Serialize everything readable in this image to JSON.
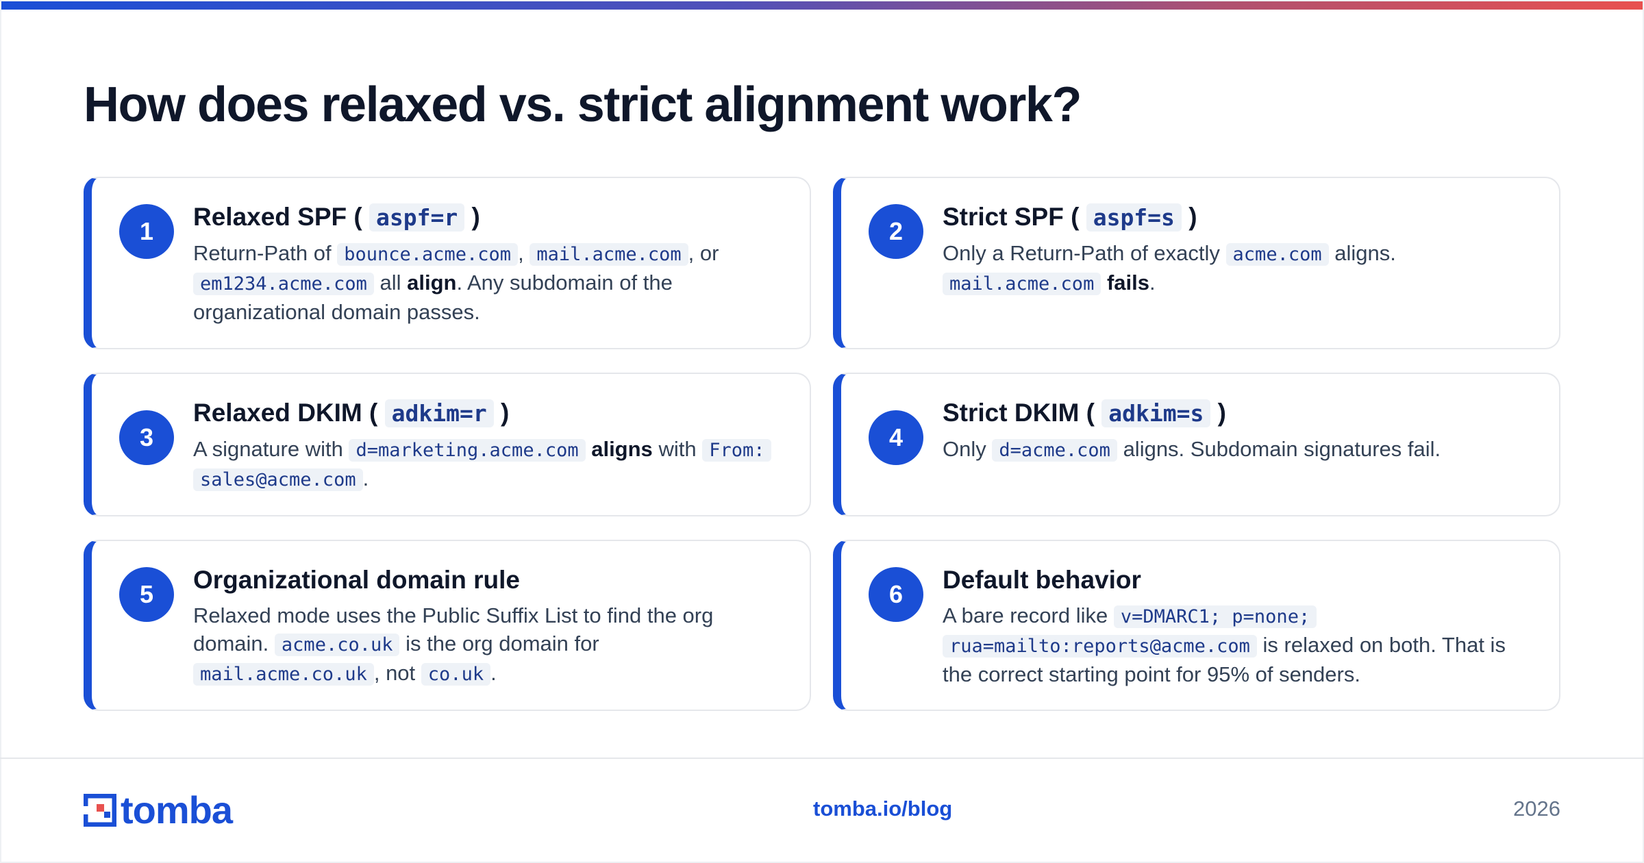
{
  "title": "How does relaxed vs. strict alignment work?",
  "cards": [
    {
      "number": "1",
      "title_text": "Relaxed SPF (",
      "title_code": "aspf=r",
      "title_end": ")",
      "parts": {
        "t1": "Return-Path of",
        "c1": "bounce.acme.com",
        "t2": ",",
        "c2": "mail.acme.com",
        "t3": ", or",
        "c3": "em1234.acme.com",
        "t4": "all",
        "b1": "align",
        "t5": ". Any subdomain of the organizational domain passes."
      }
    },
    {
      "number": "2",
      "title_text": "Strict SPF (",
      "title_code": "aspf=s",
      "title_end": ")",
      "parts": {
        "t1": "Only a Return-Path of exactly",
        "c1": "acme.com",
        "t2": "aligns.",
        "c2": "mail.acme.com",
        "b1": "fails",
        "t3": "."
      }
    },
    {
      "number": "3",
      "title_text": "Relaxed DKIM (",
      "title_code": "adkim=r",
      "title_end": ")",
      "parts": {
        "t1": "A signature with",
        "c1": "d=marketing.acme.com",
        "b1": "aligns",
        "t2": "with",
        "c2": "From:",
        "c3": "sales@acme.com",
        "t3": "."
      }
    },
    {
      "number": "4",
      "title_text": "Strict DKIM (",
      "title_code": "adkim=s",
      "title_end": ")",
      "parts": {
        "t1": "Only",
        "c1": "d=acme.com",
        "t2": "aligns. Subdomain signatures fail."
      }
    },
    {
      "number": "5",
      "title_text": "Organizational domain rule",
      "parts": {
        "t1": "Relaxed mode uses the Public Suffix List to find the org domain.",
        "c1": "acme.co.uk",
        "t2": "is the org domain for",
        "c2": "mail.acme.co.uk",
        "t3": ", not",
        "c3": "co.uk",
        "t4": "."
      }
    },
    {
      "number": "6",
      "title_text": "Default behavior",
      "parts": {
        "t1": "A bare record like",
        "c1": "v=DMARC1; p=none;",
        "c2": "rua=mailto:reports@acme.com",
        "t2": "is relaxed on both. That is the correct starting point for 95% of senders."
      }
    }
  ],
  "footer": {
    "logo_text": "tomba",
    "url": "tomba.io/blog",
    "year": "2026"
  },
  "colors": {
    "accent": "#1a4fd6",
    "gradient_end": "#e8514f",
    "text": "#0f172a",
    "muted": "#64748b"
  }
}
